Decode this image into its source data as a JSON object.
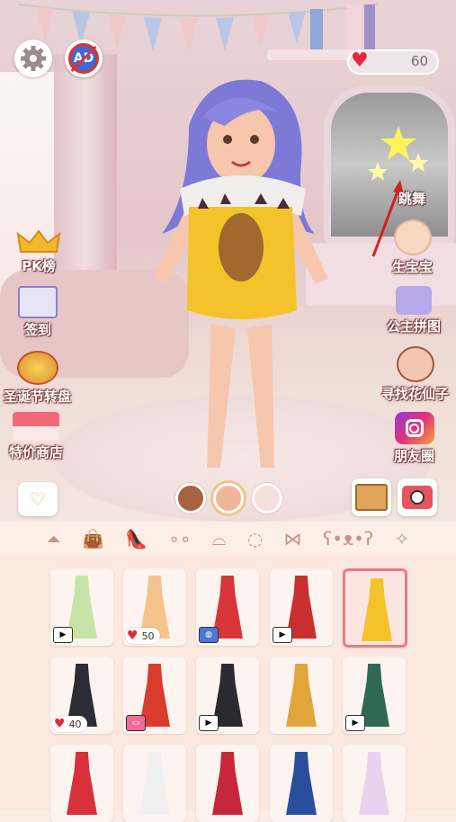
{
  "header": {
    "settings_icon": "gear-icon",
    "no_ads_text": "AD",
    "hearts": "60"
  },
  "left_menu": [
    {
      "label": "PK榜",
      "icon": "crown-icon"
    },
    {
      "label": "签到",
      "icon": "calendar-icon"
    },
    {
      "label": "圣诞节转盘",
      "icon": "wheel-icon"
    },
    {
      "label": "特价商店",
      "icon": "shop-icon"
    }
  ],
  "right_menu": [
    {
      "label": "跳舞",
      "icon": "sparkle-icon"
    },
    {
      "label": "生宝宝",
      "icon": "baby-icon"
    },
    {
      "label": "公主拼图",
      "icon": "puzzle-icon"
    },
    {
      "label": "寻找花仙子",
      "icon": "fairy-icon"
    },
    {
      "label": "朋友圈",
      "icon": "instagram-icon"
    }
  ],
  "skin_tones": [
    "#a9623f",
    "#f0b79b",
    "#f6dedb"
  ],
  "categories": [
    "dress-icon",
    "bag-icon",
    "heel-icon",
    "earring-icon",
    "hat-icon",
    "necklace-icon",
    "wings-icon",
    "teddy-icon",
    "wand-icon"
  ],
  "outfits": [
    {
      "color": "#c7e3a6",
      "badge": "video",
      "price": ""
    },
    {
      "color": "#f5c38c",
      "badge": "heart",
      "price": "50"
    },
    {
      "color": "#d8363a",
      "badge": "lock",
      "price": ""
    },
    {
      "color": "#c92f2f",
      "badge": "video",
      "price": ""
    },
    {
      "color": "#f4c22b",
      "badge": "",
      "price": "",
      "selected": true
    },
    {
      "color": "#2c2c36",
      "badge": "heart",
      "price": "40"
    },
    {
      "color": "#d93b2e",
      "badge": "tv",
      "price": ""
    },
    {
      "color": "#2a2a30",
      "badge": "video",
      "price": ""
    },
    {
      "color": "#e2a53a",
      "badge": "",
      "price": ""
    },
    {
      "color": "#2e6a52",
      "badge": "video",
      "price": ""
    },
    {
      "color": "#d7303a",
      "badge": "",
      "price": ""
    },
    {
      "color": "#f0f0f0",
      "badge": "",
      "price": ""
    },
    {
      "color": "#c8263a",
      "badge": "",
      "price": ""
    },
    {
      "color": "#2a4d9e",
      "badge": "",
      "price": ""
    },
    {
      "color": "#e9d2ee",
      "badge": "",
      "price": ""
    }
  ]
}
